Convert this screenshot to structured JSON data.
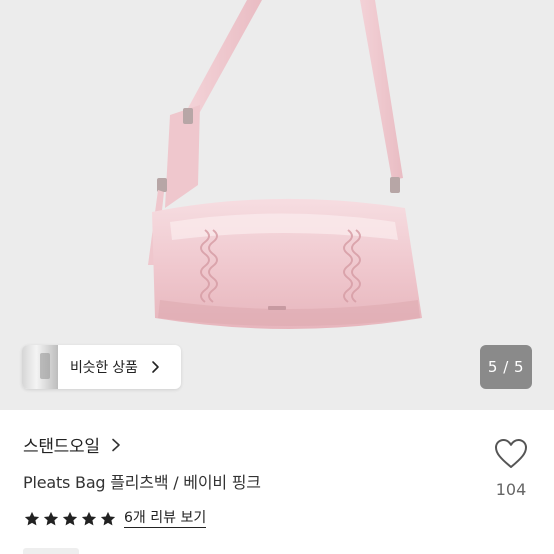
{
  "gallery": {
    "similar_label": "비슷한 상품",
    "pager_current": "5",
    "pager_total": "5",
    "pager_text": "5 / 5"
  },
  "product": {
    "store_name": "스탠드오일",
    "title": "Pleats Bag 플리츠백 / 베이비 핑크",
    "rating_stars": 5,
    "review_link": "6개 리뷰 보기",
    "like_count": "104"
  },
  "colors": {
    "bag_pink": "#f3d3d8",
    "background": "#ececec",
    "star": "#222222"
  },
  "icons": [
    "chevron-right-icon",
    "heart-outline-icon",
    "star-icon"
  ]
}
